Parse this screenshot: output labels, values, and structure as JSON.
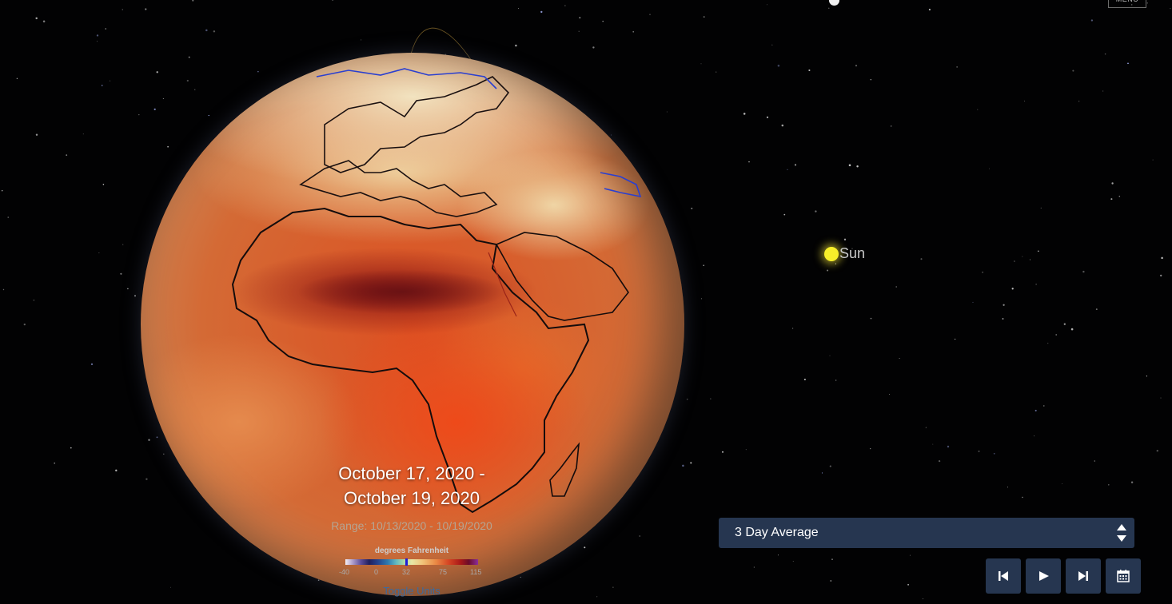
{
  "header": {
    "menu_label": "MENU",
    "menu_icon": "menu-icon"
  },
  "scene": {
    "sun_label": "Sun"
  },
  "date": {
    "line1": "October 17, 2020 -",
    "line2": "October 19, 2020",
    "range": "Range: 10/13/2020 - 10/19/2020"
  },
  "legend": {
    "title": "degrees Fahrenheit",
    "ticks": [
      "-40",
      "0",
      "32",
      "75",
      "115"
    ],
    "toggle_label": "Toggle Units"
  },
  "controls": {
    "average_select": {
      "selected": "3 Day Average"
    },
    "buttons": [
      {
        "name": "skip-back-icon"
      },
      {
        "name": "play-icon"
      },
      {
        "name": "skip-forward-icon"
      },
      {
        "name": "calendar-icon"
      }
    ]
  },
  "colors": {
    "background": "#020203",
    "control_bg": "#263650",
    "sun": "#f7ef2a",
    "toggle_link": "#3e6a9e"
  }
}
